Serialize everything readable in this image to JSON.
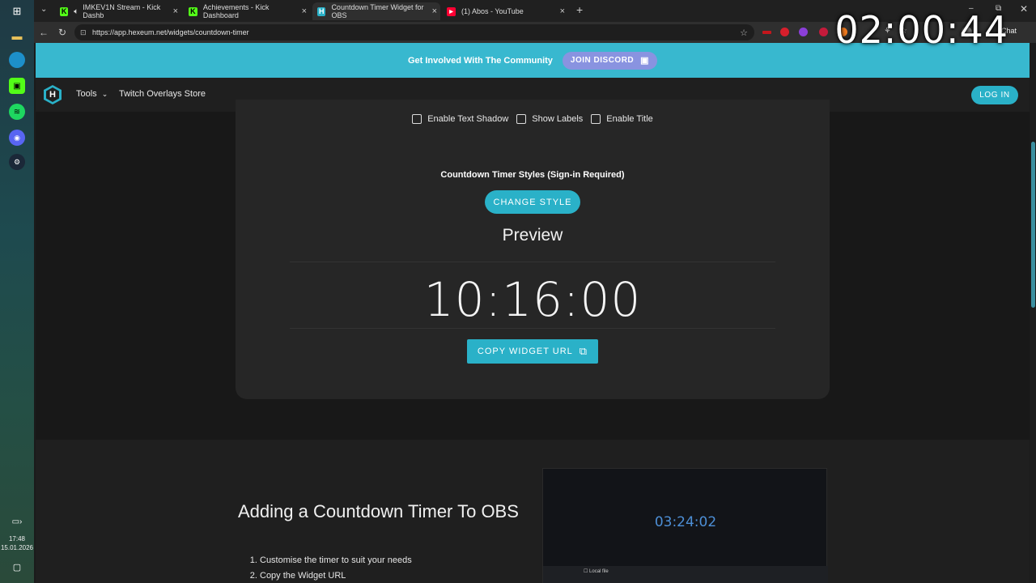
{
  "browser": {
    "tabs": [
      {
        "title": "IMKEV1N Stream - Kick Dashb",
        "favicon": "kick-icon",
        "close": "×"
      },
      {
        "title": "Achievements - Kick Dashboard",
        "favicon": "kick-icon",
        "close": "×"
      },
      {
        "title": "Countdown Timer Widget for OBS",
        "favicon": "hexeum-icon",
        "close": "×",
        "active": true
      },
      {
        "title": "(1) Abos - YouTube",
        "favicon": "youtube-icon",
        "close": "×"
      }
    ],
    "new_tab": "+",
    "url": "https://app.hexeum.net/widgets/countdown-timer",
    "chat_label": "Chat",
    "overlay_timer": "02:00:44"
  },
  "taskbar": {
    "time": "17:48",
    "date": "15.01.2026"
  },
  "banner": {
    "text": "Get Involved With The Community",
    "button": "JOIN DISCORD"
  },
  "nav": {
    "logo": "H",
    "tools": "Tools",
    "store": "Twitch Overlays Store",
    "login": "LOG IN"
  },
  "options": {
    "text_shadow": "Enable Text Shadow",
    "show_labels": "Show Labels",
    "enable_title": "Enable Title"
  },
  "styles": {
    "label": "Countdown Timer Styles (Sign-in Required)",
    "button": "CHANGE STYLE"
  },
  "preview": {
    "title": "Preview",
    "timer": "10:16:00",
    "copy_button": "COPY WIDGET URL"
  },
  "guide": {
    "title": "Adding a Countdown Timer To OBS",
    "steps": [
      "Customise the timer to suit your needs",
      "Copy the Widget URL"
    ],
    "screenshot_timer": "03:24:02",
    "screenshot_checkbox": "Local file"
  },
  "colors": {
    "accent": "#2ab1c8",
    "banner": "#38b8cf",
    "discord": "#8993e0"
  }
}
